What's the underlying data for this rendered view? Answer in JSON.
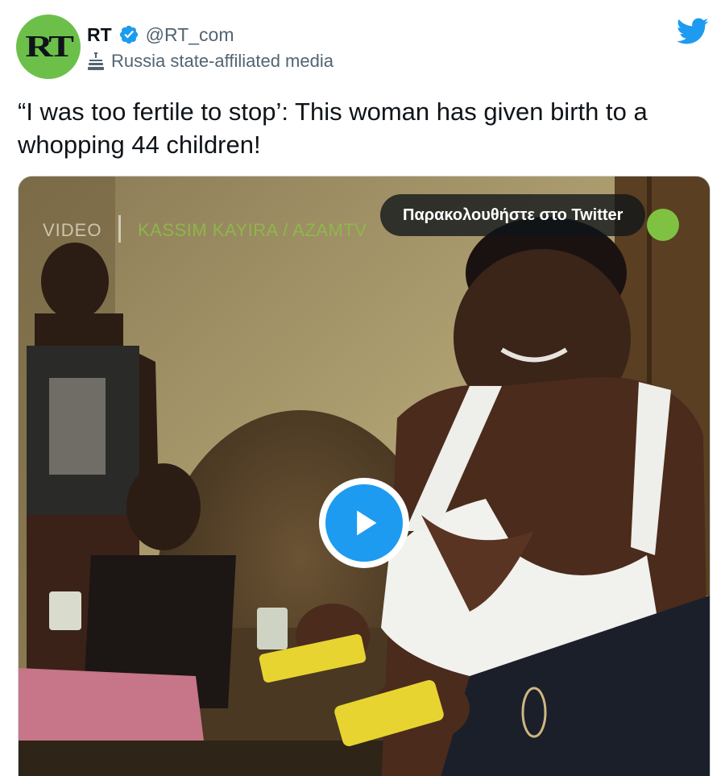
{
  "author": {
    "display_name": "RT",
    "handle": "@RT_com",
    "avatar_text": "RT",
    "verified": true,
    "state_label": "Russia state-affiliated media",
    "avatar_color": "#6cc04a"
  },
  "tweet": {
    "text": "“I was too fertile to stop’: This woman has given birth to a\nwhopping 44 children!"
  },
  "media": {
    "type": "video",
    "watch_label": "Παρακολουθήστε στο Twitter",
    "overlay_video_label": "VIDEO",
    "overlay_credit": "KASSIM KAYIRA / AZAMTV",
    "play_icon": "play-icon"
  },
  "colors": {
    "accent": "#1d9bf0",
    "text_primary": "#0f1419",
    "text_secondary": "#536471"
  },
  "icons": {
    "brand": "twitter-bird-icon",
    "verified": "verified-badge-icon",
    "state_media": "state-media-icon"
  }
}
